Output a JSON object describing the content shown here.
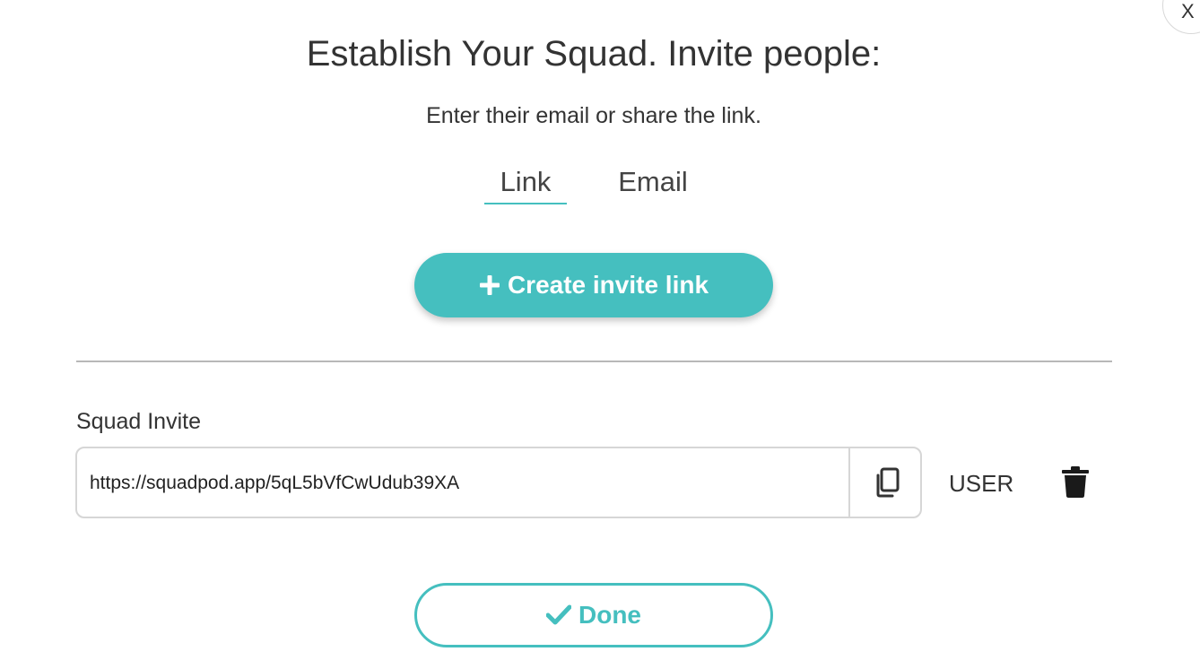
{
  "modal": {
    "close_label": "X",
    "title": "Establish Your Squad. Invite people:",
    "subtitle": "Enter their email or share the link."
  },
  "tabs": [
    {
      "label": "Link",
      "active": true
    },
    {
      "label": "Email",
      "active": false
    }
  ],
  "create_button": {
    "label": "Create invite link",
    "icon": "plus-icon"
  },
  "invite": {
    "section_label": "Squad Invite",
    "link_value": "https://squadpod.app/5qL5bVfCwUdub39XA",
    "copy_icon": "copy-icon",
    "role": "USER",
    "delete_icon": "trash-icon"
  },
  "done_button": {
    "label": "Done",
    "icon": "check-icon"
  },
  "colors": {
    "accent": "#45bfbf",
    "text": "#333333",
    "divider": "#b8b8b8",
    "field_border": "#d6d6d6"
  }
}
